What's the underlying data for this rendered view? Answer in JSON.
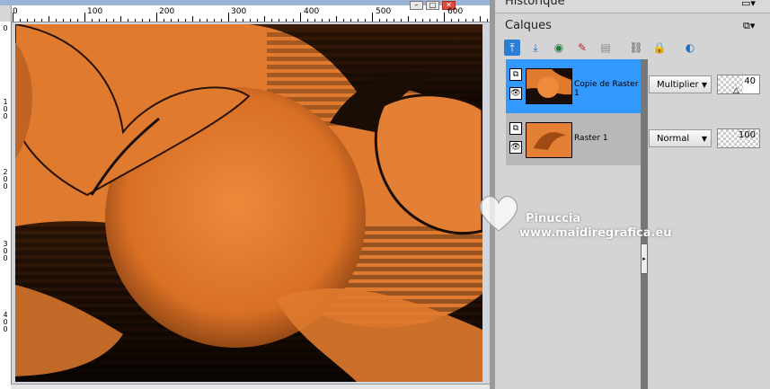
{
  "image_window": {
    "ruler_top_labels": [
      "0",
      "100",
      "200",
      "300",
      "400",
      "500",
      "600"
    ],
    "ruler_left_labels": [
      [
        "0"
      ],
      [
        "1",
        "0",
        "0"
      ],
      [
        "2",
        "0",
        "0"
      ],
      [
        "3",
        "0",
        "0"
      ],
      [
        "4",
        "0",
        "0"
      ]
    ]
  },
  "panel": {
    "historique_title": "Historique",
    "calques_title": "Calques",
    "toolbar_icons": [
      "raster-layer-icon",
      "merge-down-icon",
      "mask-icon",
      "brush-icon",
      "layer-props-icon",
      "link-icon",
      "lock-icon",
      "visibility-icon"
    ]
  },
  "layers": [
    {
      "name": "Copie de Raster 1",
      "blend_mode": "Multiplier",
      "opacity": "40",
      "selected": true
    },
    {
      "name": "Raster 1",
      "blend_mode": "Normal",
      "opacity": "100",
      "selected": false
    }
  ],
  "watermark": {
    "line1": "Pinuccia",
    "line2": "www.maidiregrafica.eu"
  },
  "colors": {
    "selection": "#3399ff",
    "canvas_orange": "#e07a2e",
    "shadow": "#1a0d05"
  }
}
